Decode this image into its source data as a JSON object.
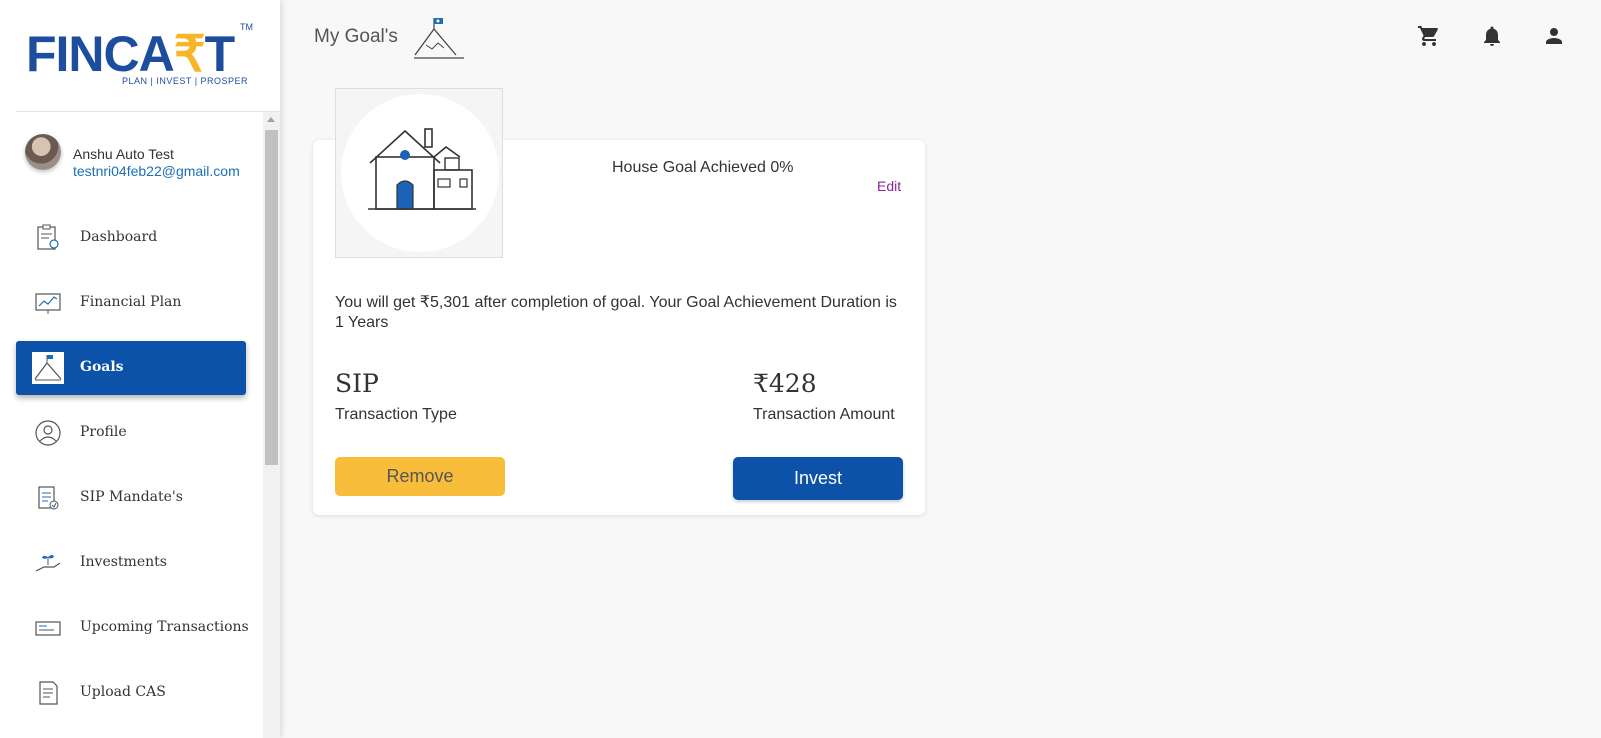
{
  "brand": {
    "logo_main_1": "FINCA",
    "logo_rupee": "₹",
    "logo_main_2": "T",
    "logo_tm": "TM",
    "tagline": "PLAN | INVEST | PROSPER",
    "primary_color": "#0b52a8",
    "accent_color": "#f6b628"
  },
  "user": {
    "name": "Anshu Auto Test",
    "email": "testnri04feb22@gmail.com"
  },
  "sidebar": {
    "items": [
      {
        "label": "Dashboard",
        "icon": "dashboard-icon",
        "active": false
      },
      {
        "label": "Financial Plan",
        "icon": "chart-icon",
        "active": false
      },
      {
        "label": "Goals",
        "icon": "mountain-flag-icon",
        "active": true
      },
      {
        "label": "Profile",
        "icon": "user-icon",
        "active": false
      },
      {
        "label": "SIP Mandate's",
        "icon": "clipboard-check-icon",
        "active": false
      },
      {
        "label": "Investments",
        "icon": "hand-plant-icon",
        "active": false
      },
      {
        "label": "Upcoming Transactions",
        "icon": "cheque-icon",
        "active": false
      },
      {
        "label": "Upload CAS",
        "icon": "document-icon",
        "active": false
      }
    ]
  },
  "header": {
    "title": "My Goal's",
    "icons": [
      "cart-icon",
      "bell-icon",
      "account-icon"
    ]
  },
  "goal_card": {
    "title": "House Goal Achieved 0%",
    "edit_label": "Edit",
    "description": "You will get ₹5,301 after completion of goal. Your Goal Achievement Duration is 1 Years",
    "transaction_type_value": "SIP",
    "transaction_type_label": "Transaction Type",
    "transaction_amount_value": "₹428",
    "transaction_amount_label": "Transaction Amount",
    "remove_label": "Remove",
    "invest_label": "Invest",
    "image_icon": "house-icon"
  }
}
